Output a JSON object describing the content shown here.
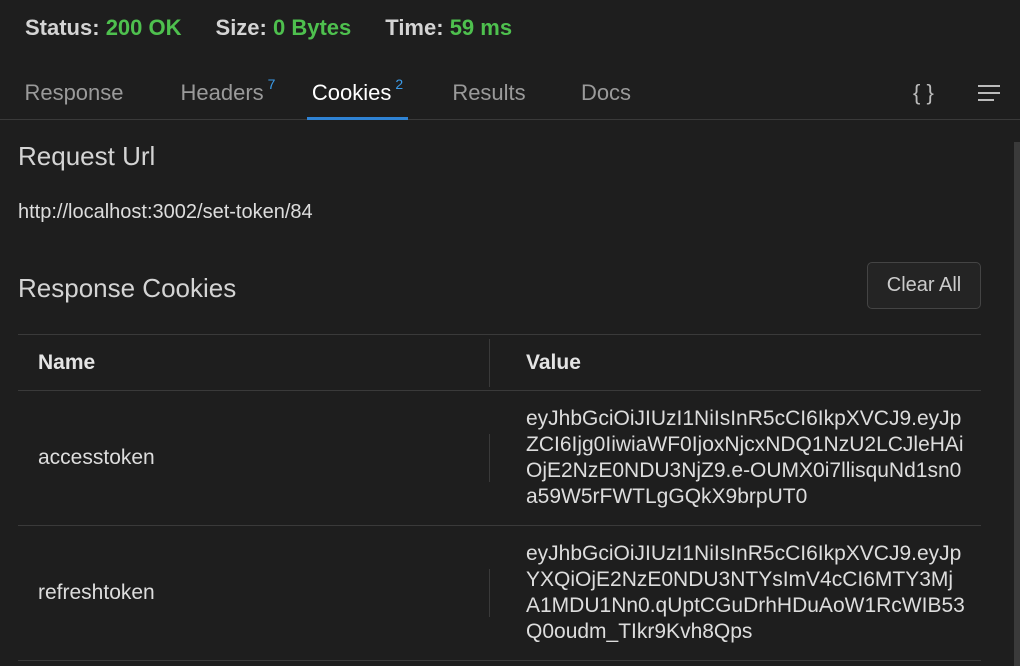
{
  "status": {
    "status_label": "Status:",
    "status_value": "200 OK",
    "size_label": "Size:",
    "size_value": "0 Bytes",
    "time_label": "Time:",
    "time_value": "59 ms"
  },
  "tabs": [
    {
      "label": "Response",
      "badge": ""
    },
    {
      "label": "Headers",
      "badge": "7"
    },
    {
      "label": "Cookies",
      "badge": "2"
    },
    {
      "label": "Results",
      "badge": ""
    },
    {
      "label": "Docs",
      "badge": ""
    }
  ],
  "active_tab": "Cookies",
  "toolbar": {
    "braces_icon": "{ }"
  },
  "request": {
    "title": "Request Url",
    "url": "http://localhost:3002/set-token/84"
  },
  "cookies": {
    "title": "Response Cookies",
    "clear_label": "Clear All",
    "columns": {
      "name": "Name",
      "value": "Value"
    },
    "rows": [
      {
        "name": "accesstoken",
        "value": "eyJhbGciOiJIUzI1NiIsInR5cCI6IkpXVCJ9.eyJpZCI6Ijg0IiwiaWF0IjoxNjcxNDQ1NzU2LCJleHAiOjE2NzE0NDU3NjZ9.e-OUMX0i7llisquNd1sn0a59W5rFWTLgGQkX9brpUT0"
      },
      {
        "name": "refreshtoken",
        "value": "eyJhbGciOiJIUzI1NiIsInR5cCI6IkpXVCJ9.eyJpYXQiOjE2NzE0NDU3NTYsImV4cCI6MTY3MjA1MDU1Nn0.qUptCGuDrhHDuAoW1RcWIB53Q0oudm_TIkr9Kvh8Qps"
      }
    ]
  },
  "colors": {
    "accent": "#2f83d4",
    "success": "#4ec04e",
    "badge": "#3b9be8",
    "background": "#1e1e1e"
  }
}
